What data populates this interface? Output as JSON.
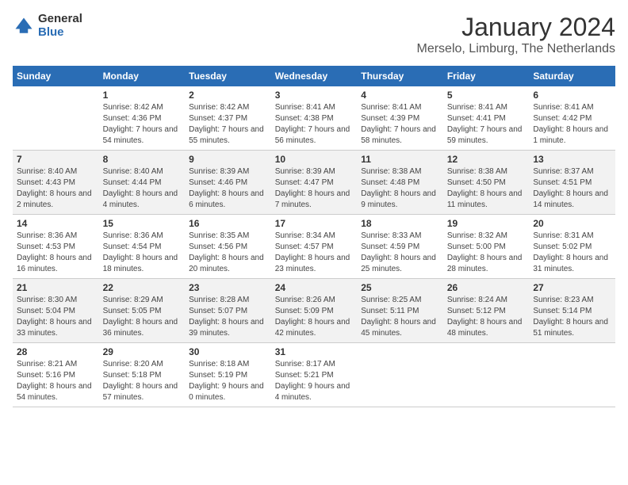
{
  "logo": {
    "general": "General",
    "blue": "Blue"
  },
  "header": {
    "month": "January 2024",
    "location": "Merselo, Limburg, The Netherlands"
  },
  "weekdays": [
    "Sunday",
    "Monday",
    "Tuesday",
    "Wednesday",
    "Thursday",
    "Friday",
    "Saturday"
  ],
  "weeks": [
    [
      {
        "day": "",
        "sunrise": "",
        "sunset": "",
        "daylight": ""
      },
      {
        "day": "1",
        "sunrise": "Sunrise: 8:42 AM",
        "sunset": "Sunset: 4:36 PM",
        "daylight": "Daylight: 7 hours and 54 minutes."
      },
      {
        "day": "2",
        "sunrise": "Sunrise: 8:42 AM",
        "sunset": "Sunset: 4:37 PM",
        "daylight": "Daylight: 7 hours and 55 minutes."
      },
      {
        "day": "3",
        "sunrise": "Sunrise: 8:41 AM",
        "sunset": "Sunset: 4:38 PM",
        "daylight": "Daylight: 7 hours and 56 minutes."
      },
      {
        "day": "4",
        "sunrise": "Sunrise: 8:41 AM",
        "sunset": "Sunset: 4:39 PM",
        "daylight": "Daylight: 7 hours and 58 minutes."
      },
      {
        "day": "5",
        "sunrise": "Sunrise: 8:41 AM",
        "sunset": "Sunset: 4:41 PM",
        "daylight": "Daylight: 7 hours and 59 minutes."
      },
      {
        "day": "6",
        "sunrise": "Sunrise: 8:41 AM",
        "sunset": "Sunset: 4:42 PM",
        "daylight": "Daylight: 8 hours and 1 minute."
      }
    ],
    [
      {
        "day": "7",
        "sunrise": "Sunrise: 8:40 AM",
        "sunset": "Sunset: 4:43 PM",
        "daylight": "Daylight: 8 hours and 2 minutes."
      },
      {
        "day": "8",
        "sunrise": "Sunrise: 8:40 AM",
        "sunset": "Sunset: 4:44 PM",
        "daylight": "Daylight: 8 hours and 4 minutes."
      },
      {
        "day": "9",
        "sunrise": "Sunrise: 8:39 AM",
        "sunset": "Sunset: 4:46 PM",
        "daylight": "Daylight: 8 hours and 6 minutes."
      },
      {
        "day": "10",
        "sunrise": "Sunrise: 8:39 AM",
        "sunset": "Sunset: 4:47 PM",
        "daylight": "Daylight: 8 hours and 7 minutes."
      },
      {
        "day": "11",
        "sunrise": "Sunrise: 8:38 AM",
        "sunset": "Sunset: 4:48 PM",
        "daylight": "Daylight: 8 hours and 9 minutes."
      },
      {
        "day": "12",
        "sunrise": "Sunrise: 8:38 AM",
        "sunset": "Sunset: 4:50 PM",
        "daylight": "Daylight: 8 hours and 11 minutes."
      },
      {
        "day": "13",
        "sunrise": "Sunrise: 8:37 AM",
        "sunset": "Sunset: 4:51 PM",
        "daylight": "Daylight: 8 hours and 14 minutes."
      }
    ],
    [
      {
        "day": "14",
        "sunrise": "Sunrise: 8:36 AM",
        "sunset": "Sunset: 4:53 PM",
        "daylight": "Daylight: 8 hours and 16 minutes."
      },
      {
        "day": "15",
        "sunrise": "Sunrise: 8:36 AM",
        "sunset": "Sunset: 4:54 PM",
        "daylight": "Daylight: 8 hours and 18 minutes."
      },
      {
        "day": "16",
        "sunrise": "Sunrise: 8:35 AM",
        "sunset": "Sunset: 4:56 PM",
        "daylight": "Daylight: 8 hours and 20 minutes."
      },
      {
        "day": "17",
        "sunrise": "Sunrise: 8:34 AM",
        "sunset": "Sunset: 4:57 PM",
        "daylight": "Daylight: 8 hours and 23 minutes."
      },
      {
        "day": "18",
        "sunrise": "Sunrise: 8:33 AM",
        "sunset": "Sunset: 4:59 PM",
        "daylight": "Daylight: 8 hours and 25 minutes."
      },
      {
        "day": "19",
        "sunrise": "Sunrise: 8:32 AM",
        "sunset": "Sunset: 5:00 PM",
        "daylight": "Daylight: 8 hours and 28 minutes."
      },
      {
        "day": "20",
        "sunrise": "Sunrise: 8:31 AM",
        "sunset": "Sunset: 5:02 PM",
        "daylight": "Daylight: 8 hours and 31 minutes."
      }
    ],
    [
      {
        "day": "21",
        "sunrise": "Sunrise: 8:30 AM",
        "sunset": "Sunset: 5:04 PM",
        "daylight": "Daylight: 8 hours and 33 minutes."
      },
      {
        "day": "22",
        "sunrise": "Sunrise: 8:29 AM",
        "sunset": "Sunset: 5:05 PM",
        "daylight": "Daylight: 8 hours and 36 minutes."
      },
      {
        "day": "23",
        "sunrise": "Sunrise: 8:28 AM",
        "sunset": "Sunset: 5:07 PM",
        "daylight": "Daylight: 8 hours and 39 minutes."
      },
      {
        "day": "24",
        "sunrise": "Sunrise: 8:26 AM",
        "sunset": "Sunset: 5:09 PM",
        "daylight": "Daylight: 8 hours and 42 minutes."
      },
      {
        "day": "25",
        "sunrise": "Sunrise: 8:25 AM",
        "sunset": "Sunset: 5:11 PM",
        "daylight": "Daylight: 8 hours and 45 minutes."
      },
      {
        "day": "26",
        "sunrise": "Sunrise: 8:24 AM",
        "sunset": "Sunset: 5:12 PM",
        "daylight": "Daylight: 8 hours and 48 minutes."
      },
      {
        "day": "27",
        "sunrise": "Sunrise: 8:23 AM",
        "sunset": "Sunset: 5:14 PM",
        "daylight": "Daylight: 8 hours and 51 minutes."
      }
    ],
    [
      {
        "day": "28",
        "sunrise": "Sunrise: 8:21 AM",
        "sunset": "Sunset: 5:16 PM",
        "daylight": "Daylight: 8 hours and 54 minutes."
      },
      {
        "day": "29",
        "sunrise": "Sunrise: 8:20 AM",
        "sunset": "Sunset: 5:18 PM",
        "daylight": "Daylight: 8 hours and 57 minutes."
      },
      {
        "day": "30",
        "sunrise": "Sunrise: 8:18 AM",
        "sunset": "Sunset: 5:19 PM",
        "daylight": "Daylight: 9 hours and 0 minutes."
      },
      {
        "day": "31",
        "sunrise": "Sunrise: 8:17 AM",
        "sunset": "Sunset: 5:21 PM",
        "daylight": "Daylight: 9 hours and 4 minutes."
      },
      {
        "day": "",
        "sunrise": "",
        "sunset": "",
        "daylight": ""
      },
      {
        "day": "",
        "sunrise": "",
        "sunset": "",
        "daylight": ""
      },
      {
        "day": "",
        "sunrise": "",
        "sunset": "",
        "daylight": ""
      }
    ]
  ]
}
